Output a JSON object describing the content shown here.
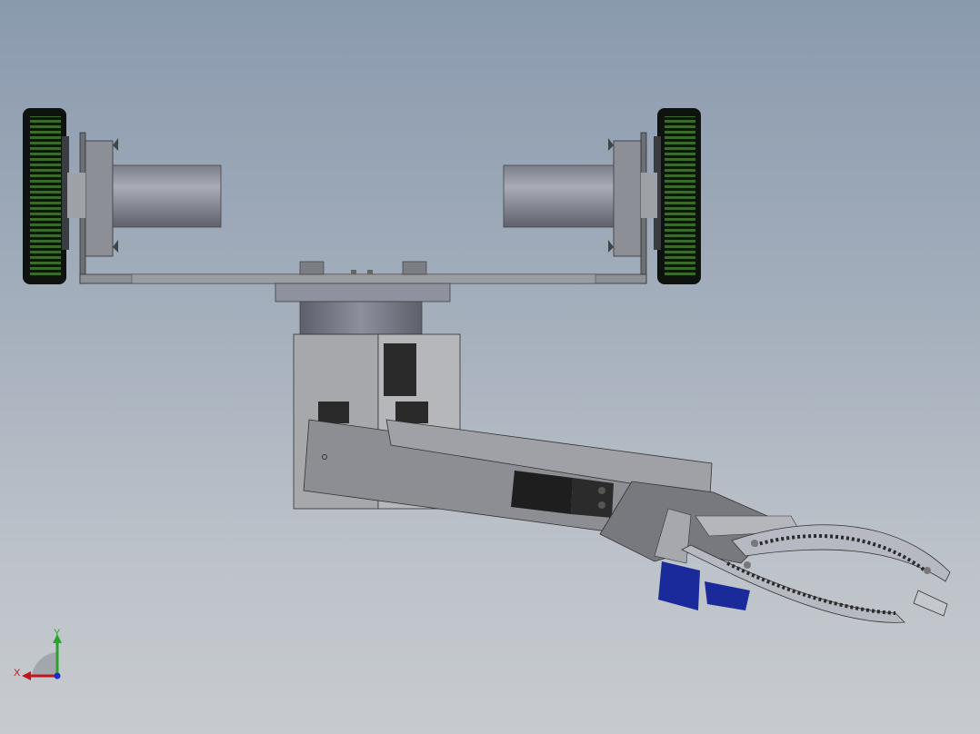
{
  "viewport": {
    "background_top": "#8a9aae",
    "background_bottom": "#c7cbcf"
  },
  "colors": {
    "tire_green": "#3b6b2a",
    "tire_dark": "#101510",
    "metal_light": "#b3b6bb",
    "metal_mid": "#8e9196",
    "metal_dark": "#5f6267",
    "servo_black": "#1e1e1e",
    "servo_blue": "#1b2a9a",
    "axis_x": "#c0151b",
    "axis_y": "#2aa32a",
    "axis_z": "#1c2cc9"
  },
  "triad": {
    "x_label": "X",
    "y_label": "Y"
  },
  "model": {
    "parts": [
      "left-wheel",
      "right-wheel",
      "left-motor",
      "right-motor",
      "chassis-plate",
      "turret-base",
      "arm-bracket",
      "upper-arm",
      "servo",
      "wrist",
      "gripper"
    ]
  }
}
